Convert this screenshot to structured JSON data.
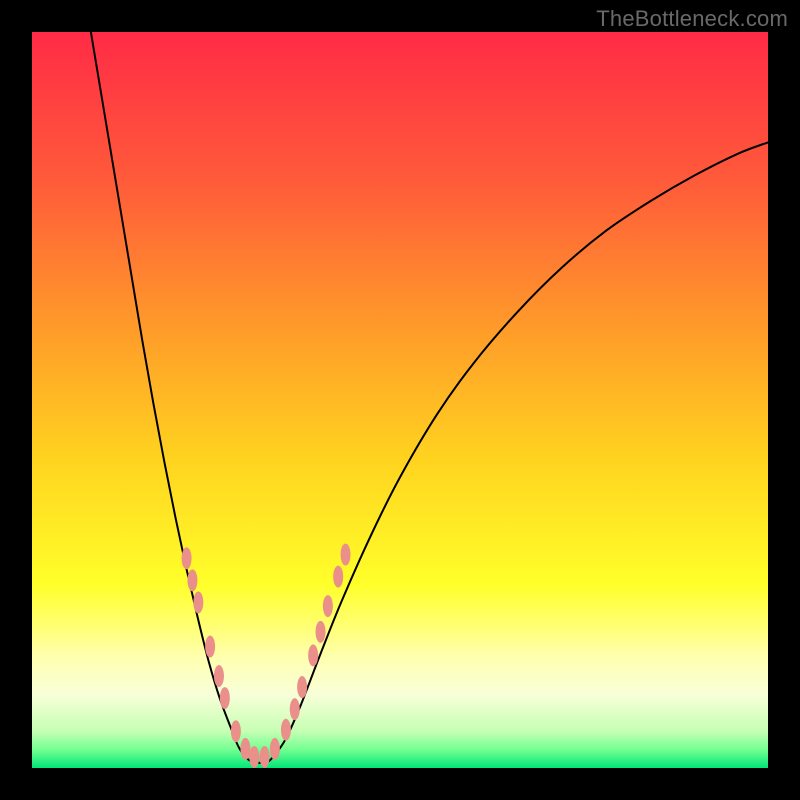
{
  "watermark": "TheBottleneck.com",
  "chart_data": {
    "type": "line",
    "title": "",
    "xlabel": "",
    "ylabel": "",
    "xlim": [
      0,
      100
    ],
    "ylim": [
      0,
      100
    ],
    "gradient_stops": [
      {
        "offset": 0.0,
        "color": "#ff2b46"
      },
      {
        "offset": 0.2,
        "color": "#ff5a3a"
      },
      {
        "offset": 0.4,
        "color": "#ff9a2a"
      },
      {
        "offset": 0.58,
        "color": "#ffd31f"
      },
      {
        "offset": 0.75,
        "color": "#ffff2a"
      },
      {
        "offset": 0.8,
        "color": "#ffff6a"
      },
      {
        "offset": 0.85,
        "color": "#ffffb0"
      },
      {
        "offset": 0.9,
        "color": "#f8ffd8"
      },
      {
        "offset": 0.95,
        "color": "#c6ffb4"
      },
      {
        "offset": 0.975,
        "color": "#74ff91"
      },
      {
        "offset": 1.0,
        "color": "#00e878"
      }
    ],
    "series": [
      {
        "name": "left-branch",
        "stroke": "#000000",
        "stroke_width": 2,
        "points": [
          {
            "x": 8.0,
            "y": 100.0
          },
          {
            "x": 9.0,
            "y": 94.0
          },
          {
            "x": 10.5,
            "y": 85.0
          },
          {
            "x": 12.0,
            "y": 76.0
          },
          {
            "x": 13.5,
            "y": 67.0
          },
          {
            "x": 15.0,
            "y": 58.0
          },
          {
            "x": 16.5,
            "y": 49.5
          },
          {
            "x": 18.0,
            "y": 41.5
          },
          {
            "x": 19.5,
            "y": 34.0
          },
          {
            "x": 21.0,
            "y": 27.0
          },
          {
            "x": 22.5,
            "y": 20.5
          },
          {
            "x": 24.0,
            "y": 14.5
          },
          {
            "x": 25.5,
            "y": 9.5
          },
          {
            "x": 27.0,
            "y": 5.5
          },
          {
            "x": 28.0,
            "y": 3.0
          },
          {
            "x": 29.0,
            "y": 1.5
          },
          {
            "x": 30.0,
            "y": 0.8
          },
          {
            "x": 31.0,
            "y": 0.7
          }
        ]
      },
      {
        "name": "right-branch",
        "stroke": "#000000",
        "stroke_width": 2,
        "points": [
          {
            "x": 31.0,
            "y": 0.7
          },
          {
            "x": 32.0,
            "y": 0.8
          },
          {
            "x": 33.0,
            "y": 1.8
          },
          {
            "x": 34.5,
            "y": 4.0
          },
          {
            "x": 36.5,
            "y": 8.5
          },
          {
            "x": 39.0,
            "y": 15.0
          },
          {
            "x": 42.0,
            "y": 22.5
          },
          {
            "x": 46.0,
            "y": 31.5
          },
          {
            "x": 50.0,
            "y": 39.5
          },
          {
            "x": 55.0,
            "y": 48.0
          },
          {
            "x": 60.0,
            "y": 55.0
          },
          {
            "x": 66.0,
            "y": 62.0
          },
          {
            "x": 72.0,
            "y": 68.0
          },
          {
            "x": 78.0,
            "y": 73.0
          },
          {
            "x": 84.0,
            "y": 77.0
          },
          {
            "x": 90.0,
            "y": 80.5
          },
          {
            "x": 96.0,
            "y": 83.5
          },
          {
            "x": 100.0,
            "y": 85.0
          }
        ]
      }
    ],
    "markers": {
      "fill": "#eb8f8b",
      "rx": 5,
      "ry": 11,
      "points": [
        {
          "x": 21.0,
          "y": 28.5
        },
        {
          "x": 21.8,
          "y": 25.5
        },
        {
          "x": 22.6,
          "y": 22.5
        },
        {
          "x": 24.2,
          "y": 16.5
        },
        {
          "x": 25.4,
          "y": 12.5
        },
        {
          "x": 26.2,
          "y": 9.5
        },
        {
          "x": 27.7,
          "y": 5.0
        },
        {
          "x": 29.0,
          "y": 2.6
        },
        {
          "x": 30.2,
          "y": 1.5
        },
        {
          "x": 31.6,
          "y": 1.5
        },
        {
          "x": 33.0,
          "y": 2.6
        },
        {
          "x": 34.5,
          "y": 5.2
        },
        {
          "x": 35.7,
          "y": 8.0
        },
        {
          "x": 36.7,
          "y": 11.0
        },
        {
          "x": 38.2,
          "y": 15.3
        },
        {
          "x": 39.2,
          "y": 18.5
        },
        {
          "x": 40.2,
          "y": 22.0
        },
        {
          "x": 41.6,
          "y": 26.0
        },
        {
          "x": 42.6,
          "y": 29.0
        }
      ]
    }
  }
}
